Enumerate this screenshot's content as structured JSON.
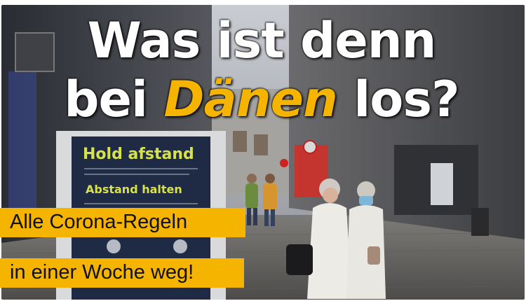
{
  "headline": {
    "line1": "Was ist denn",
    "line2_before": "bei ",
    "line2_emphasis": "Dänen",
    "line2_after": " los?"
  },
  "sign": {
    "title_1": "Hold afstand",
    "title_2": "Abstand halten"
  },
  "banners": [
    "Alle Corona-Regeln",
    "in einer Woche weg!"
  ],
  "colors": {
    "accent_yellow": "#f4b400",
    "headline_text": "#ffffff",
    "sign_green": "#d7e24a",
    "sign_background": "#1f2b44"
  }
}
